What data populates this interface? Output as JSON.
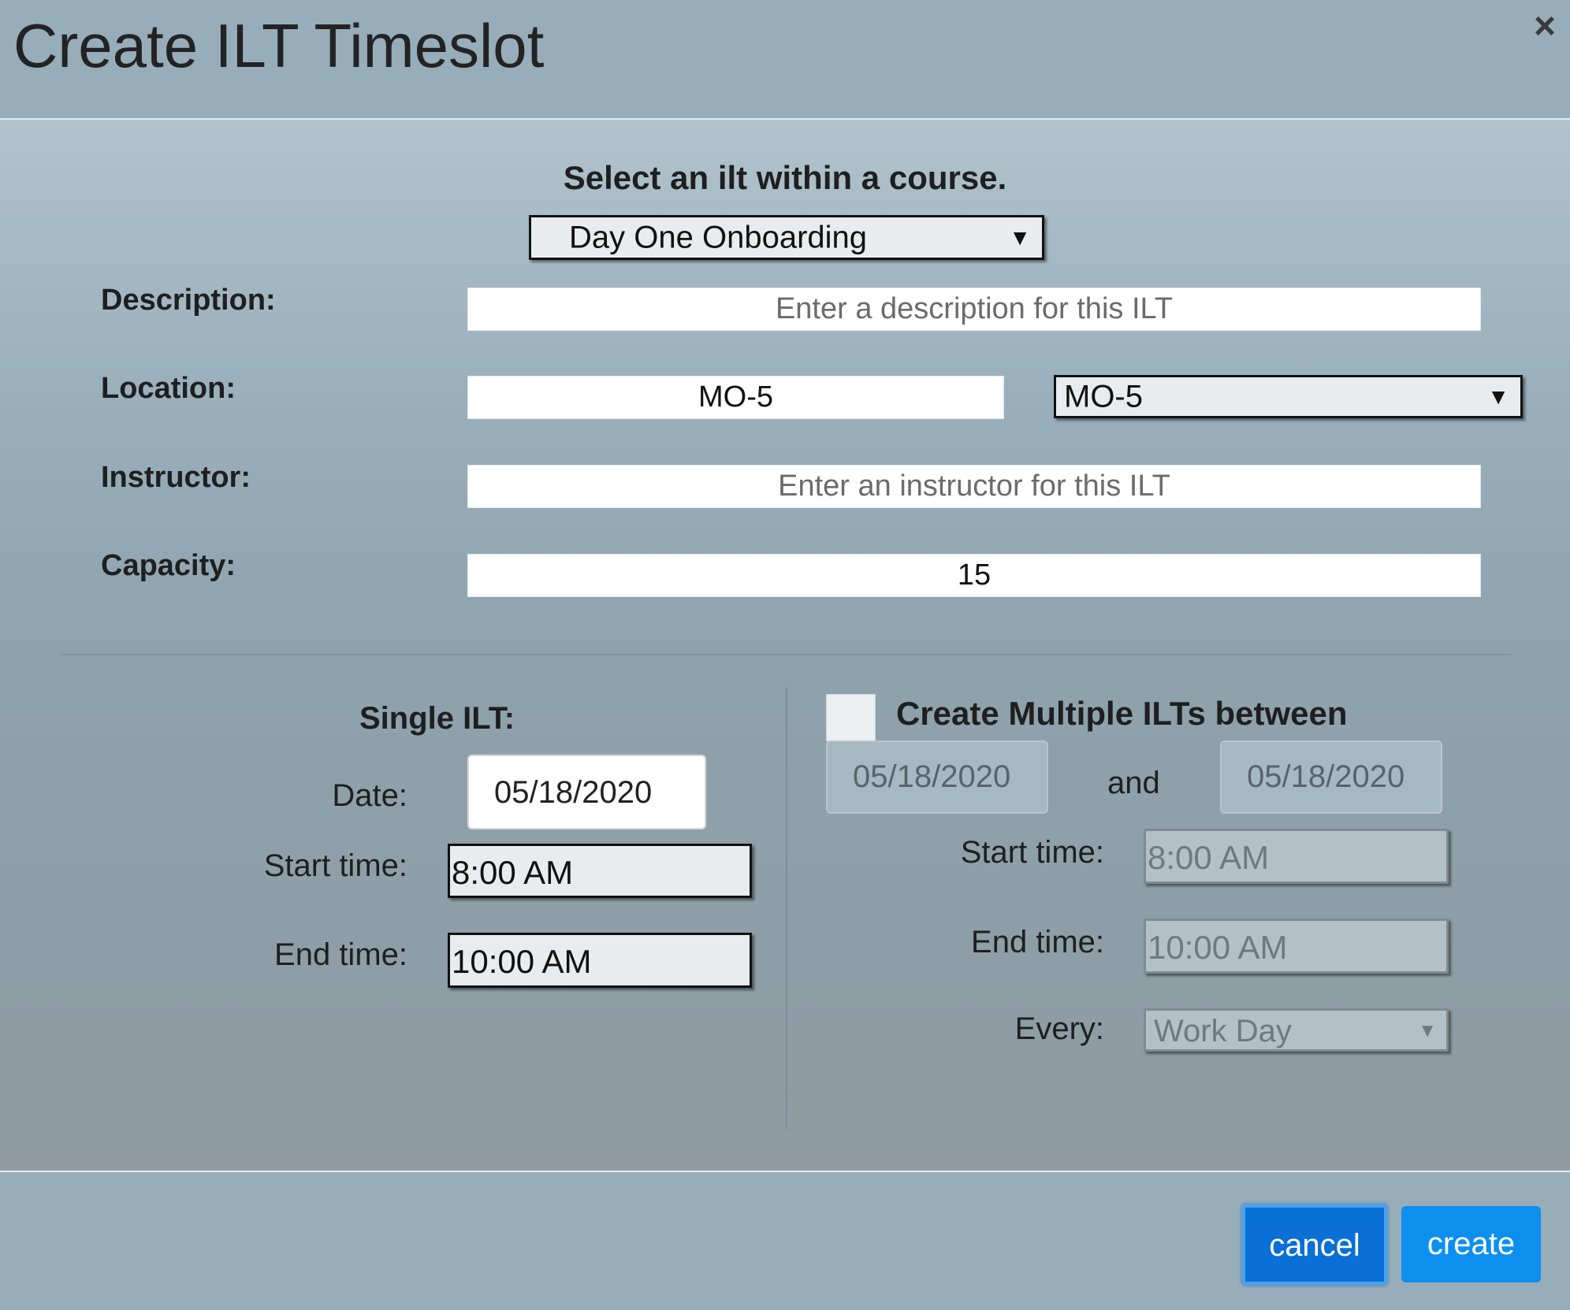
{
  "dialog": {
    "title": "Create ILT Timeslot",
    "close_label": "×"
  },
  "course": {
    "prompt": "Select an ilt within a course.",
    "selected": "Day One Onboarding"
  },
  "form": {
    "description_label": "Description:",
    "description_placeholder": "Enter a description for this ILT",
    "location_label": "Location:",
    "location_value": "MO-5",
    "location_select": "MO-5",
    "instructor_label": "Instructor:",
    "instructor_placeholder": "Enter an instructor for this ILT",
    "capacity_label": "Capacity:",
    "capacity_value": "15"
  },
  "single": {
    "heading": "Single ILT:",
    "date_label": "Date:",
    "date_value": "05/18/2020",
    "start_label": "Start time:",
    "start_value": "8:00 AM",
    "end_label": "End time:",
    "end_value": "10:00 AM"
  },
  "multiple": {
    "heading": "Create Multiple ILTs between",
    "checked": false,
    "from_date": "05/18/2020",
    "and_label": "and",
    "to_date": "05/18/2020",
    "start_label": "Start time:",
    "start_value": "8:00 AM",
    "end_label": "End time:",
    "end_value": "10:00 AM",
    "every_label": "Every:",
    "every_value": "Work Day"
  },
  "footer": {
    "cancel_label": "cancel",
    "create_label": "create"
  },
  "colors": {
    "header_bg": "#97adba",
    "button_blue": "#0d8ff0",
    "cancel_blue": "#0a6fd6"
  }
}
